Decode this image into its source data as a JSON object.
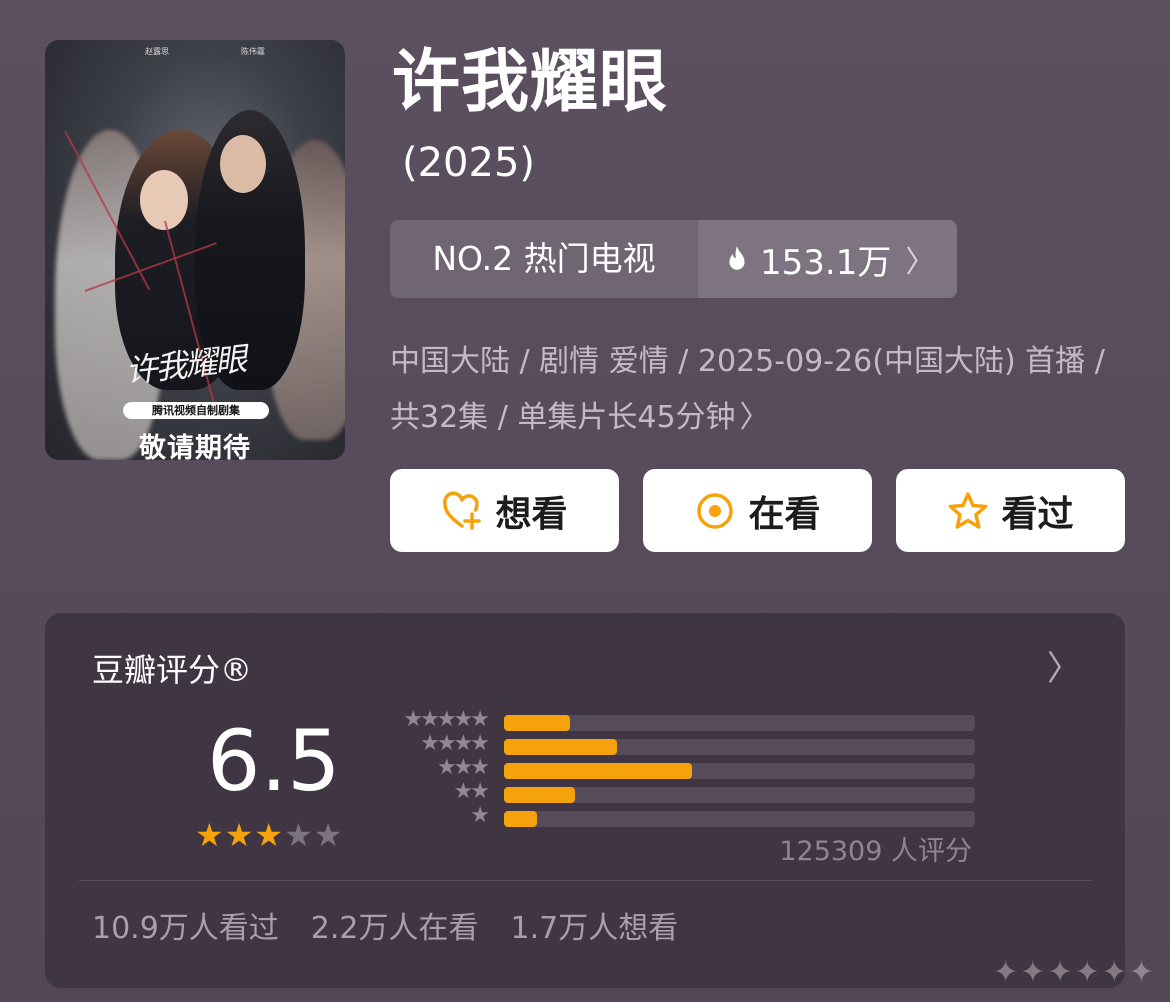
{
  "poster": {
    "cast_left": "赵露思",
    "cast_right": "陈伟霆",
    "title_art": "许我耀眼",
    "badge": "腾讯视频自制剧集",
    "stay_tuned": "敬请期待"
  },
  "show": {
    "title": "许我耀眼",
    "year": "(2025)"
  },
  "rank": {
    "label": "NO.2 热门电视",
    "heat": "153.1万"
  },
  "meta": {
    "line": "中国大陆 / 剧情 爱情 / 2025-09-26(中国大陆) 首播 / 共32集 / 单集片长45分钟"
  },
  "actions": {
    "want": "想看",
    "watching": "在看",
    "watched": "看过"
  },
  "rating": {
    "title": "豆瓣评分®",
    "score": "6.5",
    "stars_filled": 3,
    "stars_total": 5,
    "distribution": [
      {
        "stars": "★★★★★",
        "fraction": 0.14
      },
      {
        "stars": "★★★★",
        "fraction": 0.24
      },
      {
        "stars": "★★★",
        "fraction": 0.4
      },
      {
        "stars": "★★",
        "fraction": 0.15
      },
      {
        "stars": "★",
        "fraction": 0.07
      }
    ],
    "count": "125309 人评分",
    "watched": "10.9万人看过",
    "watching": "2.2万人在看",
    "want": "1.7万人想看"
  },
  "colors": {
    "accent": "#f5a20c",
    "card_bg": "#403542",
    "page_bg": "#564a5a"
  }
}
